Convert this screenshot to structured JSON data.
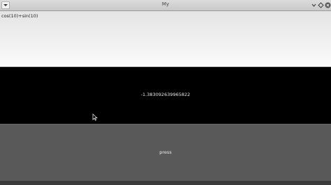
{
  "window": {
    "title": "My",
    "menu_icon": "menu-chevron-icon",
    "controls": [
      "minimize-icon",
      "maximize-icon",
      "close-icon"
    ]
  },
  "input": {
    "value": "cos(10)+sin(10)"
  },
  "result": {
    "value": "-1.383092639965822"
  },
  "button": {
    "label": "press"
  },
  "colors": {
    "input_bg": "#f0f0f0",
    "result_bg": "#000000",
    "button_bg": "#595959"
  }
}
